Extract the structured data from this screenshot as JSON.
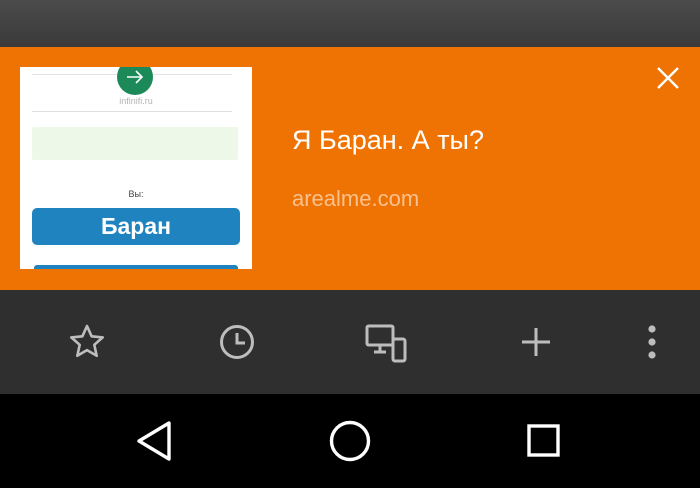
{
  "card": {
    "title": "Я Баран. А ты?",
    "url": "arealme.com",
    "accent_color": "#ef7303",
    "close_icon": "close-icon",
    "thumbnail": {
      "site": "infinifi.ru",
      "you_label": "Вы:",
      "answer": "Баран"
    }
  },
  "toolbar": {
    "items": [
      {
        "name": "bookmarks",
        "icon": "star-icon"
      },
      {
        "name": "history",
        "icon": "clock-icon"
      },
      {
        "name": "devices",
        "icon": "devices-icon"
      },
      {
        "name": "new-tab",
        "icon": "plus-icon"
      },
      {
        "name": "menu",
        "icon": "more-vertical-icon"
      }
    ]
  },
  "navbar": {
    "items": [
      {
        "name": "back",
        "icon": "back-triangle-icon"
      },
      {
        "name": "home",
        "icon": "home-circle-icon"
      },
      {
        "name": "recents",
        "icon": "recents-square-icon"
      }
    ]
  }
}
